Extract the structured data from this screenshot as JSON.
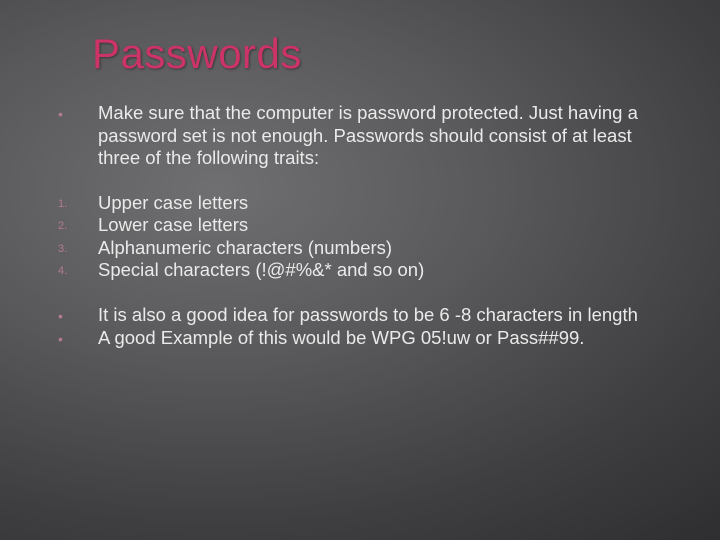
{
  "title": "Passwords",
  "intro": "Make sure that the computer is password protected. Just having a password set is not enough. Passwords should consist of at least three of the following traits:",
  "traits": {
    "m1": "1.",
    "m2": "2.",
    "m3": "3.",
    "m4": "4.",
    "t1": "Upper case letters",
    "t2": "Lower case letters",
    "t3": "Alphanumeric characters (numbers)",
    "t4": "Special characters (!@#%&* and so on)"
  },
  "notes": {
    "n1": "It is also a good idea for passwords to be 6 -8 characters in length",
    "n2": "A good Example of this would be  WPG 05!uw or Pass##99."
  },
  "dot": "•"
}
